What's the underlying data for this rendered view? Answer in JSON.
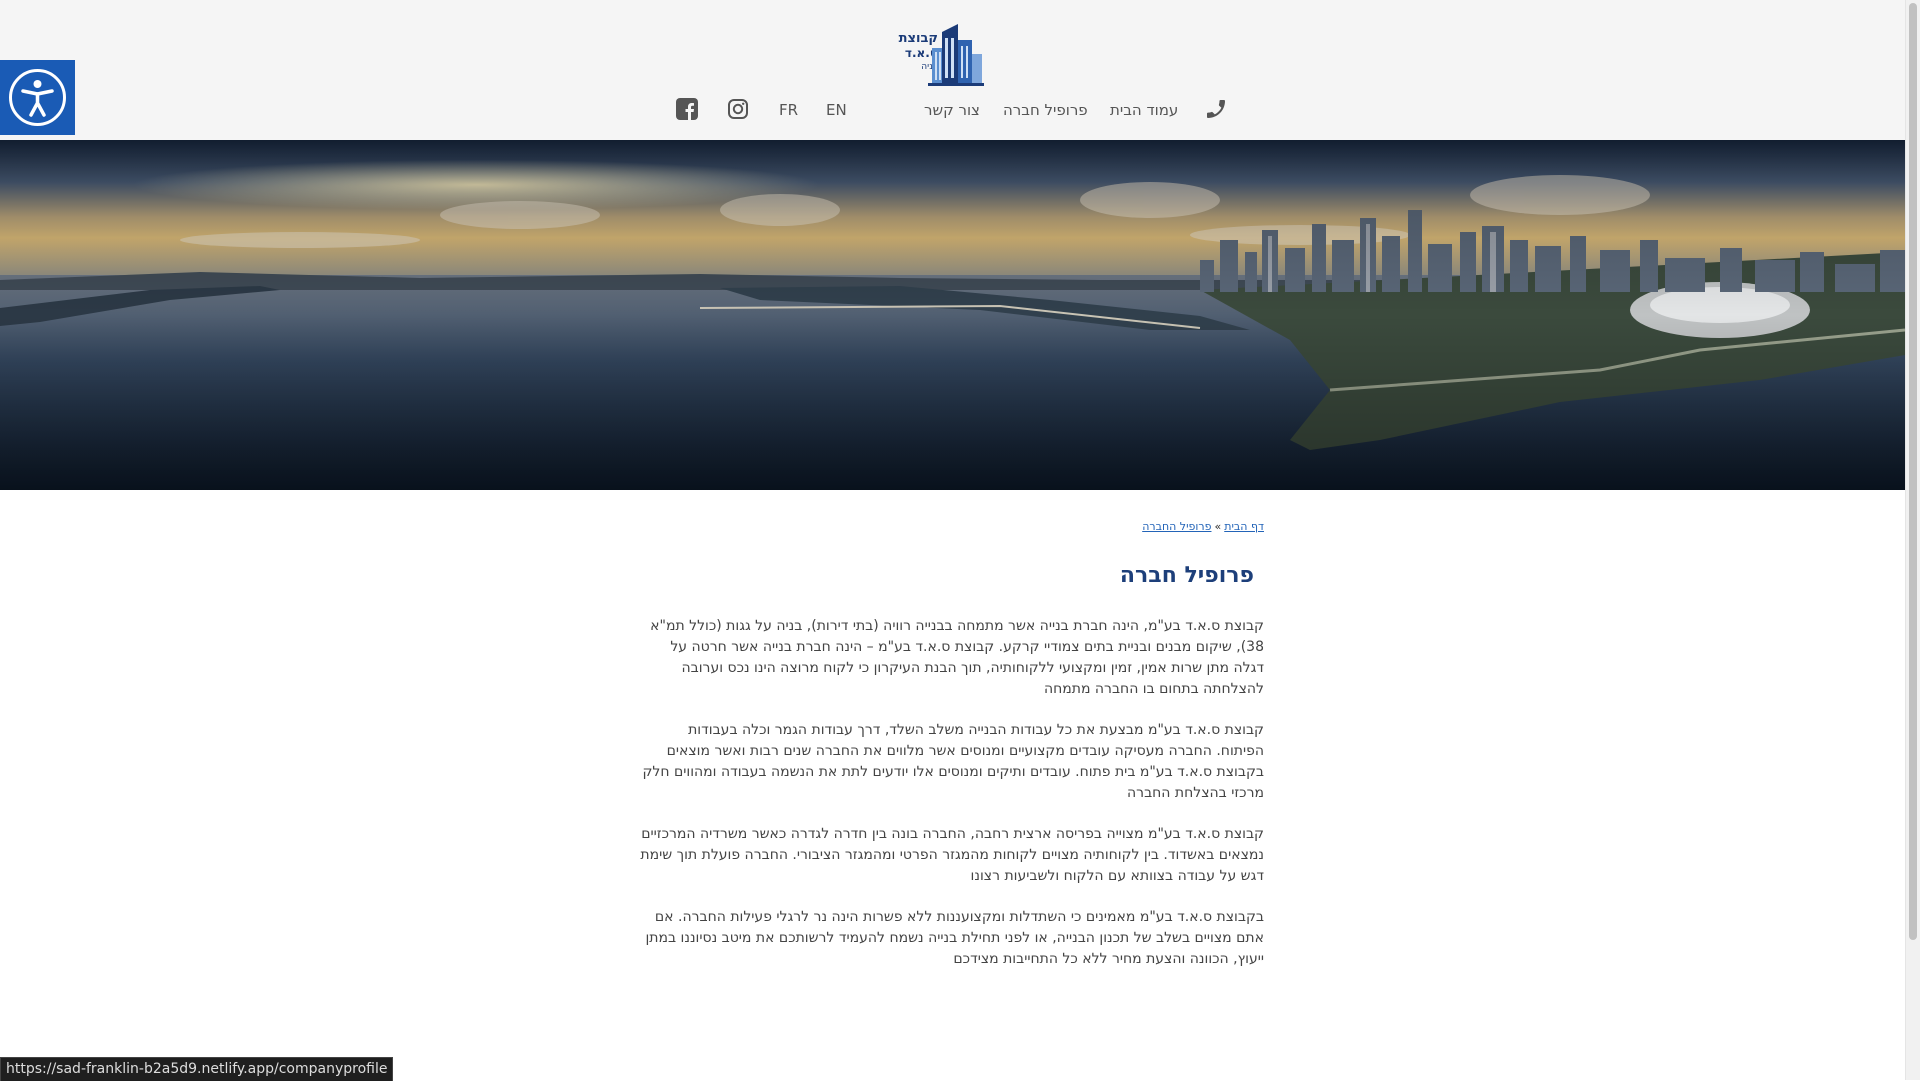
{
  "header": {
    "logo": {
      "line1": "קבוצת",
      "line2": "ס.א.ד",
      "line3": "בניה"
    },
    "nav": {
      "phone_icon": "phone-icon",
      "home": "עמוד הבית",
      "company_profile": "פרופיל חברה",
      "contact": "צור קשר",
      "lang_en": "EN",
      "lang_fr": "FR",
      "instagram_icon": "instagram-icon",
      "facebook_icon": "facebook-icon"
    }
  },
  "accessibility": {
    "icon": "accessibility-icon",
    "color": "#1a5bb5"
  },
  "hero": {
    "alt": "panorama-city-skyline"
  },
  "breadcrumb": {
    "home": "דף הבית",
    "separator": "»",
    "current": "פרופיל החברה"
  },
  "content": {
    "title": "פרופיל חברה",
    "paragraphs": [
      "קבוצת ס.א.ד בע\"מ, הינה חברת בנייה אשר מתמחה בבנייה רוויה (בתי דירות), בניה על גגות (כולל תמ\"א 38), שיקום מבנים ובניית בתים צמודיי קרקע. קבוצת ס.א.ד בע\"מ – הינה חברת בנייה אשר חרטה על דגלה מתן שרות אמין, זמין ומקצועי ללקוחותיה, תוך הבנת העיקרון כי לקוח מרוצה הינו נכס וערובה להצלחתה בתחום בו החברה מתמחה",
      "קבוצת ס.א.ד בע\"מ מבצעת את כל עבודות הבנייה משלב השלד, דרך עבודות הגמר וכלה בעבודות הפיתוח. החברה מעסיקה עובדים מקצועיים ומנוסים אשר מלווים את החברה שנים רבות ואשר מוצאים בקבוצת ס.א.ד בע\"מ בית פתוח. עובדים ותיקים ומנוסים אלו יודעים לתת את הנשמה בעבודה ומהווים חלק מרכזי בהצלחת החברה",
      "קבוצת ס.א.ד בע\"מ מצוייה בפריסה ארצית רחבה, החברה בונה בין חדרה לגדרה כאשר משרדיה המרכזיים נמצאים באשדוד. בין לקוחותיה מצויים לקוחות מהמגזר הפרטי ומהמגזר הציבורי. החברה פועלת תוך שימת דגש על עבודה בצוותא עם הלקוח ולשביעות רצונו",
      "בקבוצת ס.א.ד בע\"מ מאמינים כי השתדלות ומקצועננות ללא פשרות הינה נר לרגלי פעילות החברה. אם אתם מצויים בשלב של תכנון הבנייה, או לפני תחילת בנייה נשמח להעמיד לרשותכם את מיטב נסיוננו במתן ייעוץ, הכוונה והצעת מחיר ללא כל התחייבות מצידכם"
    ]
  },
  "status_bar": {
    "url": "https://sad-franklin-b2a5d9.netlify.app/companyprofile"
  },
  "colors": {
    "brand": "#1d3f7a",
    "link": "#2364b8",
    "header_bg": "#f5f5f5"
  }
}
